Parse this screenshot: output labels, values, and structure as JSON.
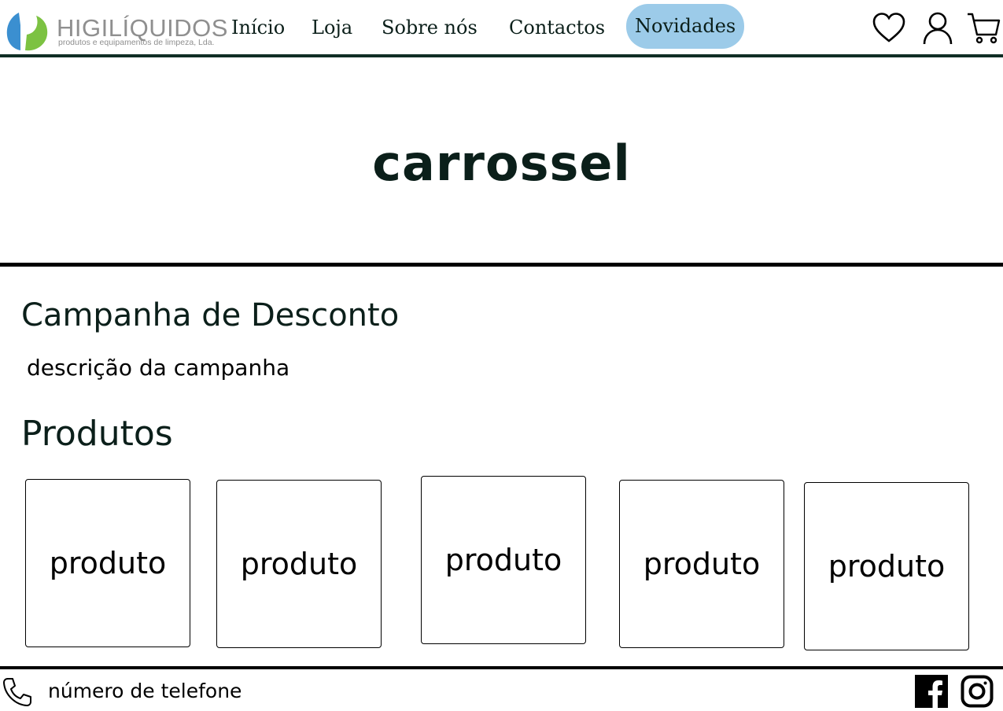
{
  "brand": {
    "name": "HIGILÍQUIDOS",
    "tagline": "produtos e equipamentos de limpeza, Lda.",
    "colors": {
      "blue": "#3b8fd0",
      "green": "#7cc242",
      "text": "#8f8f8f"
    }
  },
  "nav": {
    "items": [
      {
        "label": "Início"
      },
      {
        "label": "Loja"
      },
      {
        "label": "Sobre nós"
      },
      {
        "label": "Contactos"
      },
      {
        "label": "Novidades",
        "active": true
      }
    ],
    "active_color": "#9ccbe9"
  },
  "header_icons": [
    "heart-icon",
    "user-icon",
    "cart-icon"
  ],
  "hero": {
    "text": "carrossel"
  },
  "campaign": {
    "title": "Campanha de Desconto",
    "description": "descrição da campanha"
  },
  "products": {
    "title": "Produtos",
    "items": [
      {
        "label": "produto"
      },
      {
        "label": "produto"
      },
      {
        "label": "produto"
      },
      {
        "label": "produto"
      },
      {
        "label": "produto"
      }
    ]
  },
  "footer": {
    "phone_label": "número de telefone",
    "social": [
      "facebook-icon",
      "instagram-icon"
    ]
  }
}
